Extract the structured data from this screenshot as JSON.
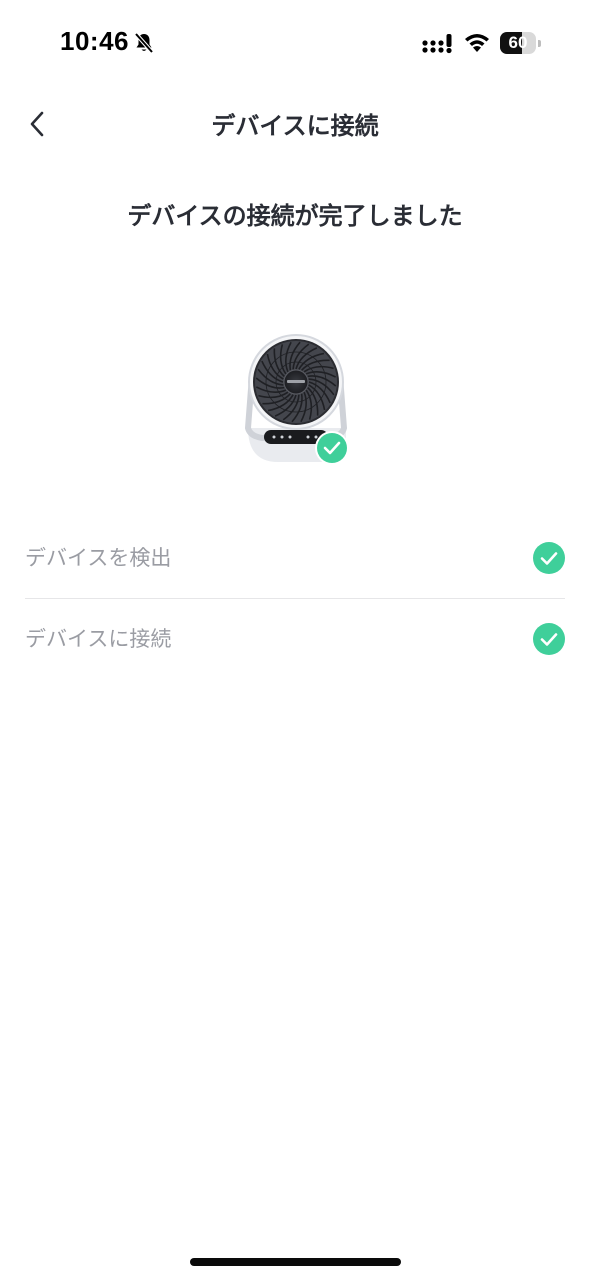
{
  "status_bar": {
    "time": "10:46",
    "battery_level": "60",
    "battery_percent": 60,
    "icons": [
      "bell-off-icon",
      "signal-icon",
      "wifi-icon",
      "battery-icon"
    ]
  },
  "nav": {
    "title": "デバイスに接続",
    "back_icon": "chevron-left-icon"
  },
  "heading": "デバイスの接続が完了しました",
  "device": {
    "image": "desk-fan-illustration",
    "status_icon": "check-circle-icon"
  },
  "steps": [
    {
      "label": "デバイスを検出",
      "status": "done",
      "icon": "check-circle-icon"
    },
    {
      "label": "デバイスに接続",
      "status": "done",
      "icon": "check-circle-icon"
    }
  ],
  "colors": {
    "accent_green": "#3fcf9a",
    "title_text": "#2a2d35",
    "muted_text": "#9a9ca3",
    "divider": "#e6e6e8"
  }
}
